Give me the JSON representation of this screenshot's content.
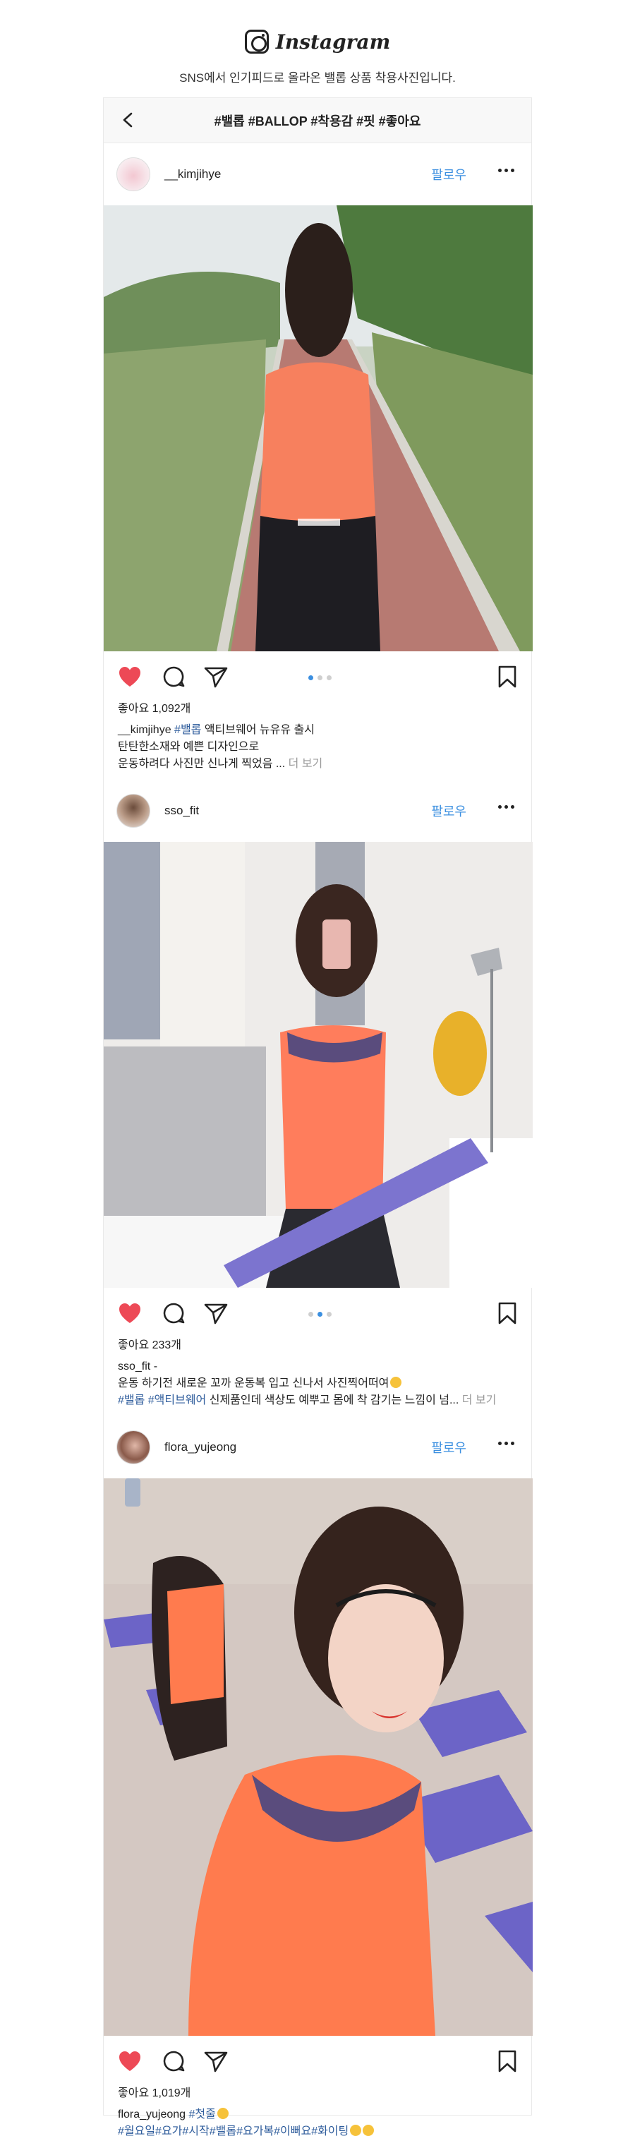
{
  "brand": {
    "name": "Instagram",
    "subtitle": "SNS에서 인기피드로 올라온 밸롭 상품 착용사진입니다."
  },
  "topbar": {
    "title": "#밸롭 #BALLOP #착용감 #핏 #좋아요"
  },
  "posts": [
    {
      "username": "__kimjihye",
      "follow_label": "팔로우",
      "likes": "좋아요 1,092개",
      "caption_user": "__kimjihye",
      "caption_tag": "#밸롭",
      "caption_line1": " 액티브웨어 뉴유유 출시",
      "caption_line2": "탄탄한소재와 예쁜 디자인으로",
      "caption_line3": "운동하려다 사진만 신나게 찍었음 ...",
      "more_label": "더 보기"
    },
    {
      "username": "sso_fit",
      "follow_label": "팔로우",
      "likes": "좋아요 233개",
      "caption_user": "sso_fit -",
      "caption_line1": "운동 하기전 새로운 꼬까 운동복 입고 신나서 사진찍어떠여",
      "caption_tags": "#밸롭 #액티브웨어",
      "caption_line2": " 신제품인데 색상도 예뿌고 몸에 착 감기는 느낌이 넘...",
      "more_label": "더 보기"
    },
    {
      "username": "flora_yujeong",
      "follow_label": "팔로우",
      "likes": "좋아요 1,019개",
      "caption_user": "flora_yujeong",
      "caption_tag": "#첫줄",
      "caption_tags": "#월요일#요가#시작#밸롭#요가복#이뻐요#화이팅"
    }
  ],
  "colors": {
    "accent": "#3b8fe0",
    "heart": "#ed4956",
    "hashtag": "#2f5d9c",
    "muted": "#9a9a9a"
  },
  "icons": [
    "instagram-logo-icon",
    "back-chevron-icon",
    "more-dots-icon",
    "heart-icon",
    "comment-icon",
    "share-icon",
    "bookmark-icon"
  ]
}
